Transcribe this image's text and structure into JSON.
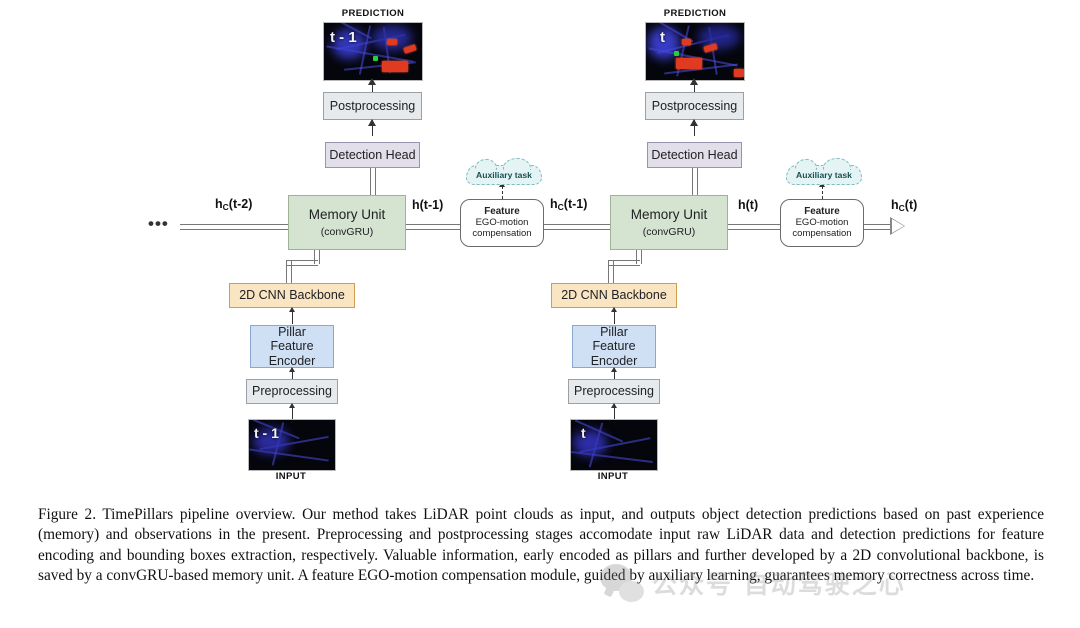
{
  "figure": {
    "columns": [
      {
        "id": "left",
        "time_label": "t - 1",
        "prediction_caption": "PREDICTION",
        "input_caption": "INPUT",
        "blocks": {
          "postprocessing": "Postprocessing",
          "detection_head": "Detection Head",
          "memory_unit_title": "Memory Unit",
          "memory_unit_sub": "(convGRU)",
          "backbone": "2D CNN Backbone",
          "pillar_encoder": "Pillar Feature Encoder",
          "preprocessing": "Preprocessing"
        }
      },
      {
        "id": "right",
        "time_label": "t",
        "prediction_caption": "PREDICTION",
        "input_caption": "INPUT",
        "blocks": {
          "postprocessing": "Postprocessing",
          "detection_head": "Detection Head",
          "memory_unit_title": "Memory Unit",
          "memory_unit_sub": "(convGRU)",
          "backbone": "2D CNN Backbone",
          "pillar_encoder": "Pillar Feature Encoder",
          "preprocessing": "Preprocessing"
        }
      }
    ],
    "ego_modules": [
      {
        "title": "Feature",
        "line2": "EGO-motion",
        "line3": "compensation"
      },
      {
        "title": "Feature",
        "line2": "EGO-motion",
        "line3": "compensation"
      }
    ],
    "auxiliary_task_label": "Auxiliary task",
    "edge_labels": {
      "hc_t_minus_2": "h_C(t-2)",
      "h_t_minus_1": "h(t-1)",
      "hc_t_minus_1": "h_C(t-1)",
      "h_t": "h(t)",
      "hc_t": "h_C(t)"
    },
    "ellipsis": "•••",
    "colors": {
      "memory_unit": "#d5e3d1",
      "backbone": "#fae5c3",
      "pillar_encoder": "#cfe0f5",
      "preprocessing": "#e7eaec",
      "postprocessing": "#e7eaec",
      "detection_head": "#e2dfeb",
      "auxiliary_cloud": "#e4f4f4",
      "connector": "#777777"
    }
  },
  "caption": {
    "text": "Figure 2. TimePillars pipeline overview. Our method takes LiDAR point clouds as input, and outputs object detection predictions based on past experience (memory) and observations in the present. Preprocessing and postprocessing stages accomodate input raw LiDAR data and detection predictions for feature encoding and bounding boxes extraction, respectively. Valuable information, early encoded as pillars and further developed by a 2D convolutional backbone, is saved by a convGRU-based memory unit. A feature EGO-motion compensation module, guided by auxiliary learning, guarantees memory correctness across time."
  },
  "watermark": {
    "text": "公众号 自动驾驶之心",
    "icon": "wechat-logo"
  }
}
